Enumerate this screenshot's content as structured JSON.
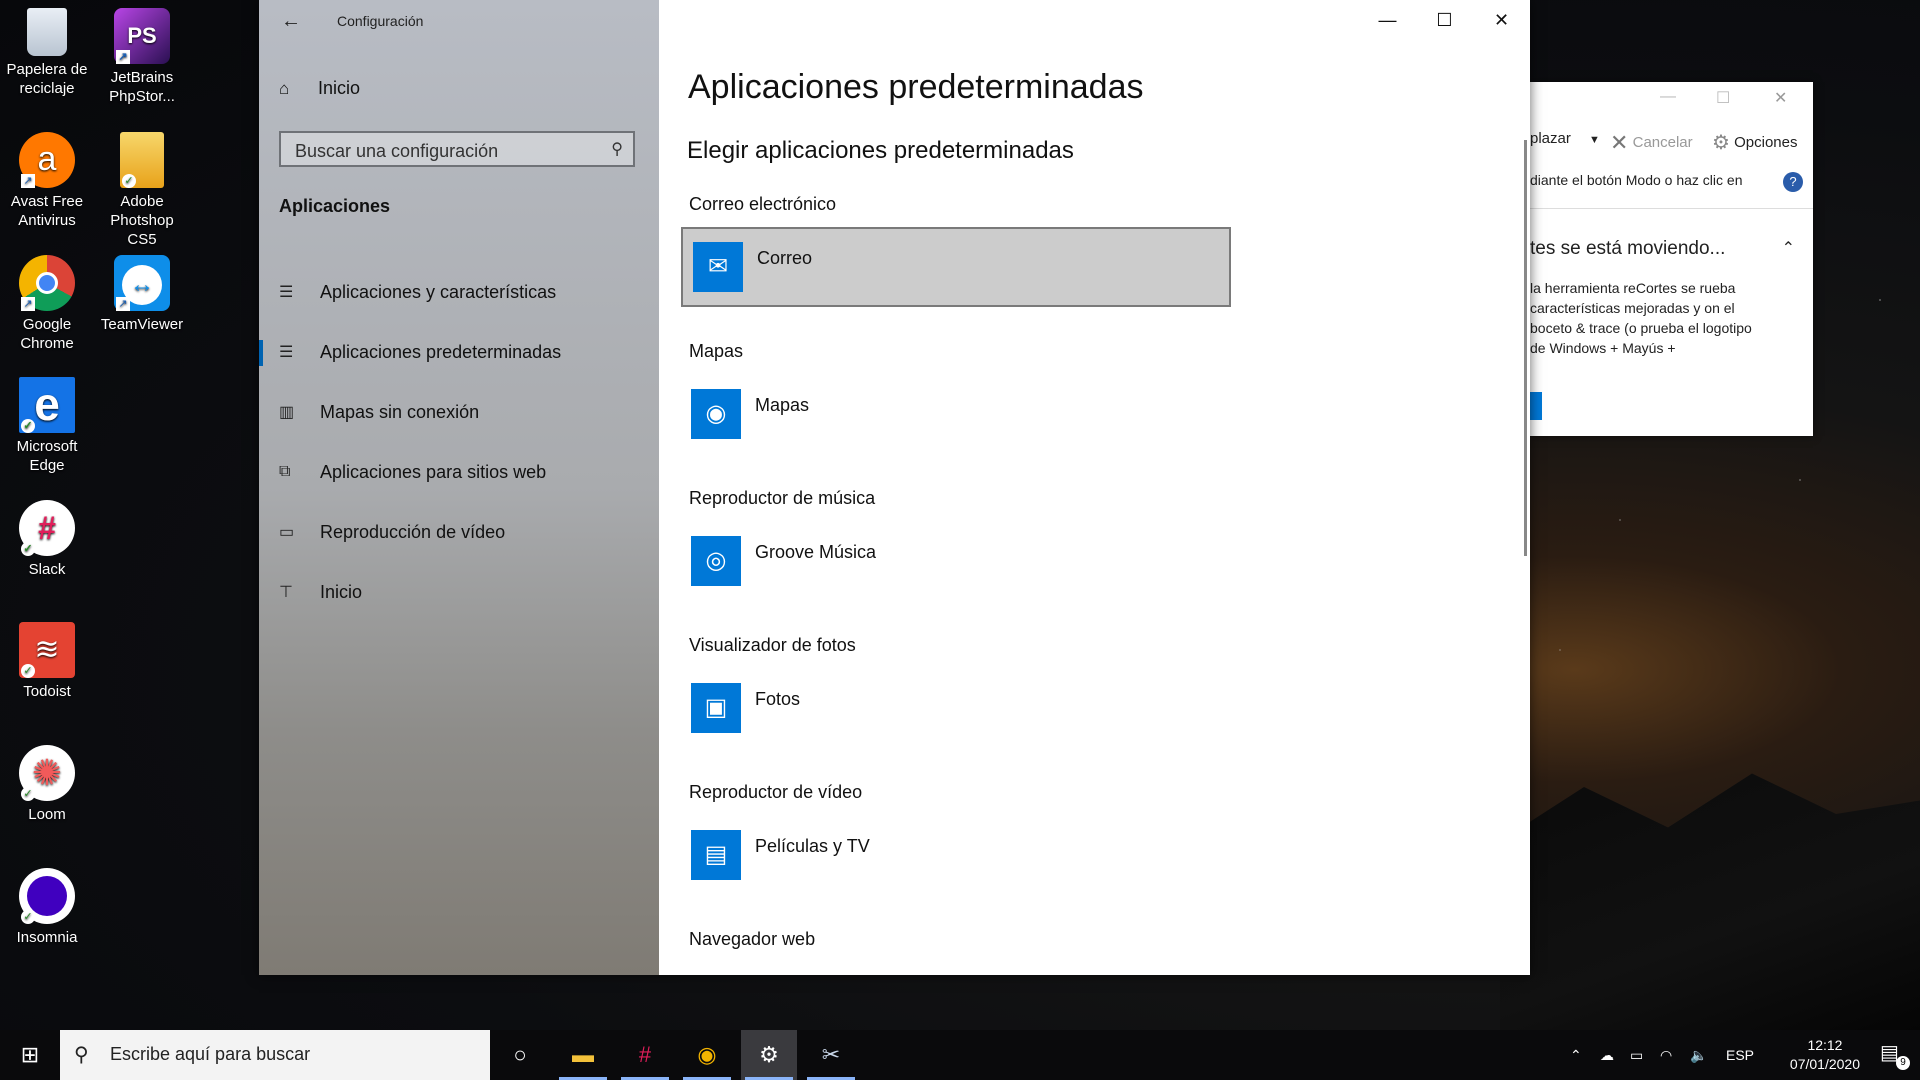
{
  "desktop": {
    "icons": [
      {
        "label": "Papelera de reciclaje",
        "icon": "recycle-bin-icon"
      },
      {
        "label": "JetBrains PhpStor...",
        "icon": "phpstorm-icon"
      },
      {
        "label": "Avast Free Antivirus",
        "icon": "avast-icon"
      },
      {
        "label": "Adobe Photshop CS5",
        "icon": "photoshop-icon"
      },
      {
        "label": "Google Chrome",
        "icon": "chrome-icon"
      },
      {
        "label": "TeamViewer",
        "icon": "teamviewer-icon"
      },
      {
        "label": "Microsoft Edge",
        "icon": "edge-icon"
      },
      {
        "label": "Slack",
        "icon": "slack-icon"
      },
      {
        "label": "Todoist",
        "icon": "todoist-icon"
      },
      {
        "label": "Loom",
        "icon": "loom-icon"
      },
      {
        "label": "Insomnia",
        "icon": "insomnia-icon"
      }
    ]
  },
  "settings": {
    "window_title": "Configuración",
    "home_label": "Inicio",
    "search_placeholder": "Buscar una configuración",
    "section_title": "Aplicaciones",
    "nav": [
      {
        "label": "Aplicaciones y características",
        "icon": "list-icon",
        "active": false
      },
      {
        "label": "Aplicaciones predeterminadas",
        "icon": "list-icon",
        "active": true
      },
      {
        "label": "Mapas sin conexión",
        "icon": "map-icon",
        "active": false
      },
      {
        "label": "Aplicaciones para sitios web",
        "icon": "link-window-icon",
        "active": false
      },
      {
        "label": "Reproducción de vídeo",
        "icon": "video-icon",
        "active": false
      },
      {
        "label": "Inicio",
        "icon": "startup-icon",
        "active": false
      }
    ],
    "page_title": "Aplicaciones predeterminadas",
    "subtitle": "Elegir aplicaciones predeterminadas",
    "defaults": [
      {
        "category": "Correo electrónico",
        "app": "Correo",
        "icon": "mail-icon",
        "selected": true
      },
      {
        "category": "Mapas",
        "app": "Mapas",
        "icon": "maps-icon",
        "selected": false
      },
      {
        "category": "Reproductor de música",
        "app": "Groove Música",
        "icon": "groove-icon",
        "selected": false
      },
      {
        "category": "Visualizador de fotos",
        "app": "Fotos",
        "icon": "photos-icon",
        "selected": false
      },
      {
        "category": "Reproductor de vídeo",
        "app": "Películas y TV",
        "icon": "movies-icon",
        "selected": false
      },
      {
        "category": "Navegador web",
        "app": "",
        "icon": "",
        "selected": false
      }
    ]
  },
  "snipping": {
    "delay_label": "plazar",
    "cancel_label": "Cancelar",
    "options_label": "Opciones",
    "hint": "diante el botón Modo o haz clic en",
    "notice_title": "tes se está moviendo...",
    "notice_body": "la herramienta reCortes se rueba características mejoradas y on el boceto & trace (o prueba el logotipo de Windows + Mayús +"
  },
  "taskbar": {
    "search_placeholder": "Escribe aquí para buscar",
    "language": "ESP",
    "time": "12:12",
    "date": "07/01/2020",
    "notification_count": "9"
  }
}
